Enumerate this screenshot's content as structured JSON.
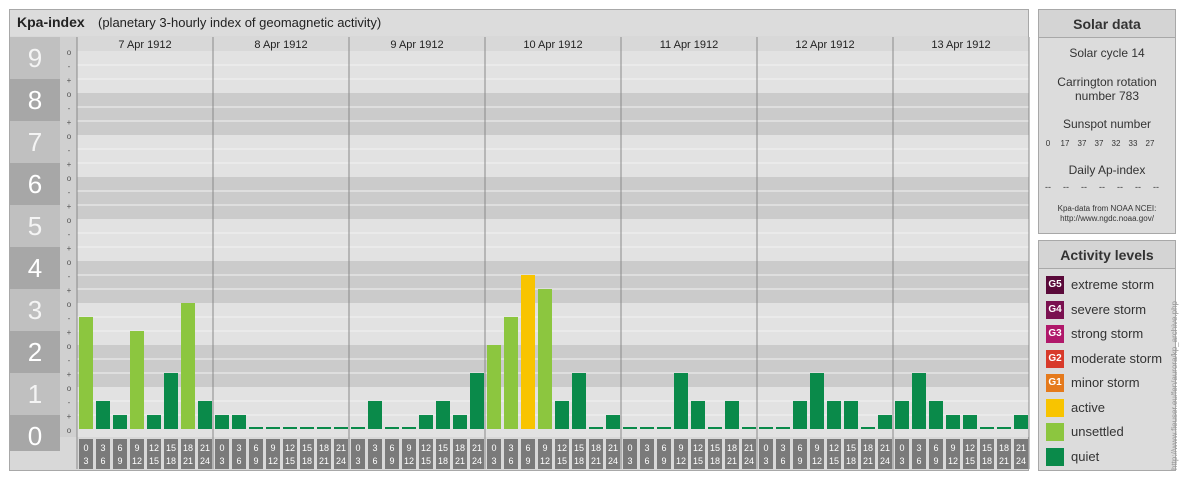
{
  "header": {
    "title": "Kpa-index",
    "subtitle": "(planetary 3-hourly index of geomagnetic activity)"
  },
  "solar": {
    "heading": "Solar data",
    "cycle": "Solar cycle 14",
    "carrington_line1": "Carrington rotation",
    "carrington_line2": "number 783",
    "sunspot_label": "Sunspot number",
    "sunspot_values": [
      "0",
      "17",
      "37",
      "37",
      "32",
      "33",
      "27"
    ],
    "ap_label": "Daily Ap-index",
    "ap_values": [
      "--",
      "--",
      "--",
      "--",
      "--",
      "--",
      "--"
    ],
    "source_line1": "Kpa-data from NOAA NCEI:",
    "source_line2": "http://www.ngdc.noaa.gov/"
  },
  "activity": {
    "heading": "Activity levels",
    "levels": [
      {
        "code": "G5",
        "label": "extreme storm",
        "color": "#5a0a3a"
      },
      {
        "code": "G4",
        "label": "severe storm",
        "color": "#7a1050"
      },
      {
        "code": "G3",
        "label": "strong storm",
        "color": "#b0186a"
      },
      {
        "code": "G2",
        "label": "moderate storm",
        "color": "#d83a2a"
      },
      {
        "code": "G1",
        "label": "minor storm",
        "color": "#e57a1c"
      },
      {
        "code": "",
        "label": "active",
        "color": "#f8c400"
      },
      {
        "code": "",
        "label": "unsettled",
        "color": "#8cc63f"
      },
      {
        "code": "",
        "label": "quiet",
        "color": "#0a8a4a"
      }
    ]
  },
  "watermark": "http://www.fieuser.eu/fen/aurora/kp_archive.php",
  "chart_data": {
    "type": "bar",
    "title": "Kpa-index",
    "subtitle": "(planetary 3-hourly index of geomagnetic activity)",
    "y_ticks": [
      "0",
      "1",
      "2",
      "3",
      "4",
      "5",
      "6",
      "7",
      "8",
      "9"
    ],
    "y_minor_ticks": [
      "o",
      "+",
      "-"
    ],
    "ylim": [
      0,
      9
    ],
    "hour_start_labels": [
      "0",
      "3",
      "6",
      "9",
      "12",
      "15",
      "18",
      "21"
    ],
    "hour_end_labels": [
      "3",
      "6",
      "9",
      "12",
      "15",
      "18",
      "21",
      "24"
    ],
    "days": [
      {
        "date": "7 Apr 1912",
        "values": [
          2.667,
          0.667,
          0.333,
          2.333,
          0.333,
          1.333,
          3.0,
          0.667
        ]
      },
      {
        "date": "8 Apr 1912",
        "values": [
          0.333,
          0.333,
          0.0,
          0.0,
          0.0,
          0.0,
          0.0,
          0.0
        ]
      },
      {
        "date": "9 Apr 1912",
        "values": [
          0.0,
          0.667,
          0.0,
          0.0,
          0.333,
          0.667,
          0.333,
          1.333
        ]
      },
      {
        "date": "10 Apr 1912",
        "values": [
          2.0,
          2.667,
          3.667,
          3.333,
          0.667,
          1.333,
          0.0,
          0.333
        ]
      },
      {
        "date": "11 Apr 1912",
        "values": [
          0.0,
          0.0,
          0.0,
          1.333,
          0.667,
          0.0,
          0.667,
          0.0
        ]
      },
      {
        "date": "12 Apr 1912",
        "values": [
          0.0,
          0.0,
          0.667,
          1.333,
          0.667,
          0.667,
          0.0,
          0.333
        ]
      },
      {
        "date": "13 Apr 1912",
        "values": [
          0.667,
          1.333,
          0.667,
          0.333,
          0.333,
          0.0,
          0.0,
          0.333
        ]
      }
    ],
    "colors": {
      "quiet": "#0a8a4a",
      "unsettled": "#8cc63f",
      "active": "#f8c400"
    },
    "grid": true,
    "legend": "right"
  }
}
